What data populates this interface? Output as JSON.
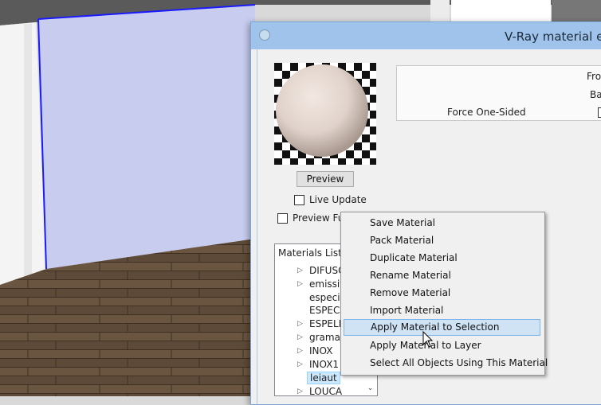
{
  "window": {
    "title": "V-Ray material ed"
  },
  "preview": {
    "button_label": "Preview",
    "live_update_label": "Live Update",
    "live_update_checked": false,
    "full_label": "Preview Full M",
    "full_checked": false
  },
  "options_panel": {
    "front_label": "Fron",
    "back_label": "Bac",
    "force_one_sided_label": "Force One-Sided"
  },
  "materials_list": {
    "header": "Materials List",
    "items": [
      {
        "label": "DIFUSO",
        "expandable": true
      },
      {
        "label": "emissive",
        "expandable": true
      },
      {
        "label": "especial",
        "expandable": false
      },
      {
        "label": "ESPECIA",
        "expandable": false
      },
      {
        "label": "ESPELH",
        "expandable": true
      },
      {
        "label": "grama",
        "expandable": true
      },
      {
        "label": "INOX",
        "expandable": true
      },
      {
        "label": "INOX1",
        "expandable": true
      },
      {
        "label": "leiaut",
        "expandable": false,
        "selected": true
      },
      {
        "label": "LOUCA",
        "expandable": true
      }
    ]
  },
  "context_menu": {
    "items": [
      {
        "label": "Save Material"
      },
      {
        "label": "Pack Material"
      },
      {
        "label": "Duplicate Material"
      },
      {
        "label": "Rename Material"
      },
      {
        "label": "Remove Material"
      },
      {
        "label": "Import Material"
      },
      {
        "label": "Apply Material to Selection",
        "highlighted": true
      },
      {
        "label": "Apply Material to Layer"
      },
      {
        "label": "Select All Objects Using This Material"
      }
    ]
  },
  "icons": {
    "expand": "triangle-right-icon",
    "scroll": "chevron-down-icon",
    "cursor": "pointer-cursor-icon"
  },
  "colors": {
    "title_bar": "#9fc3ea",
    "menu_highlight": "#cfe3f5",
    "wall_selected": "#c8cdf0",
    "selection_edge": "#1a1aff",
    "floor": "#5e4a38"
  }
}
